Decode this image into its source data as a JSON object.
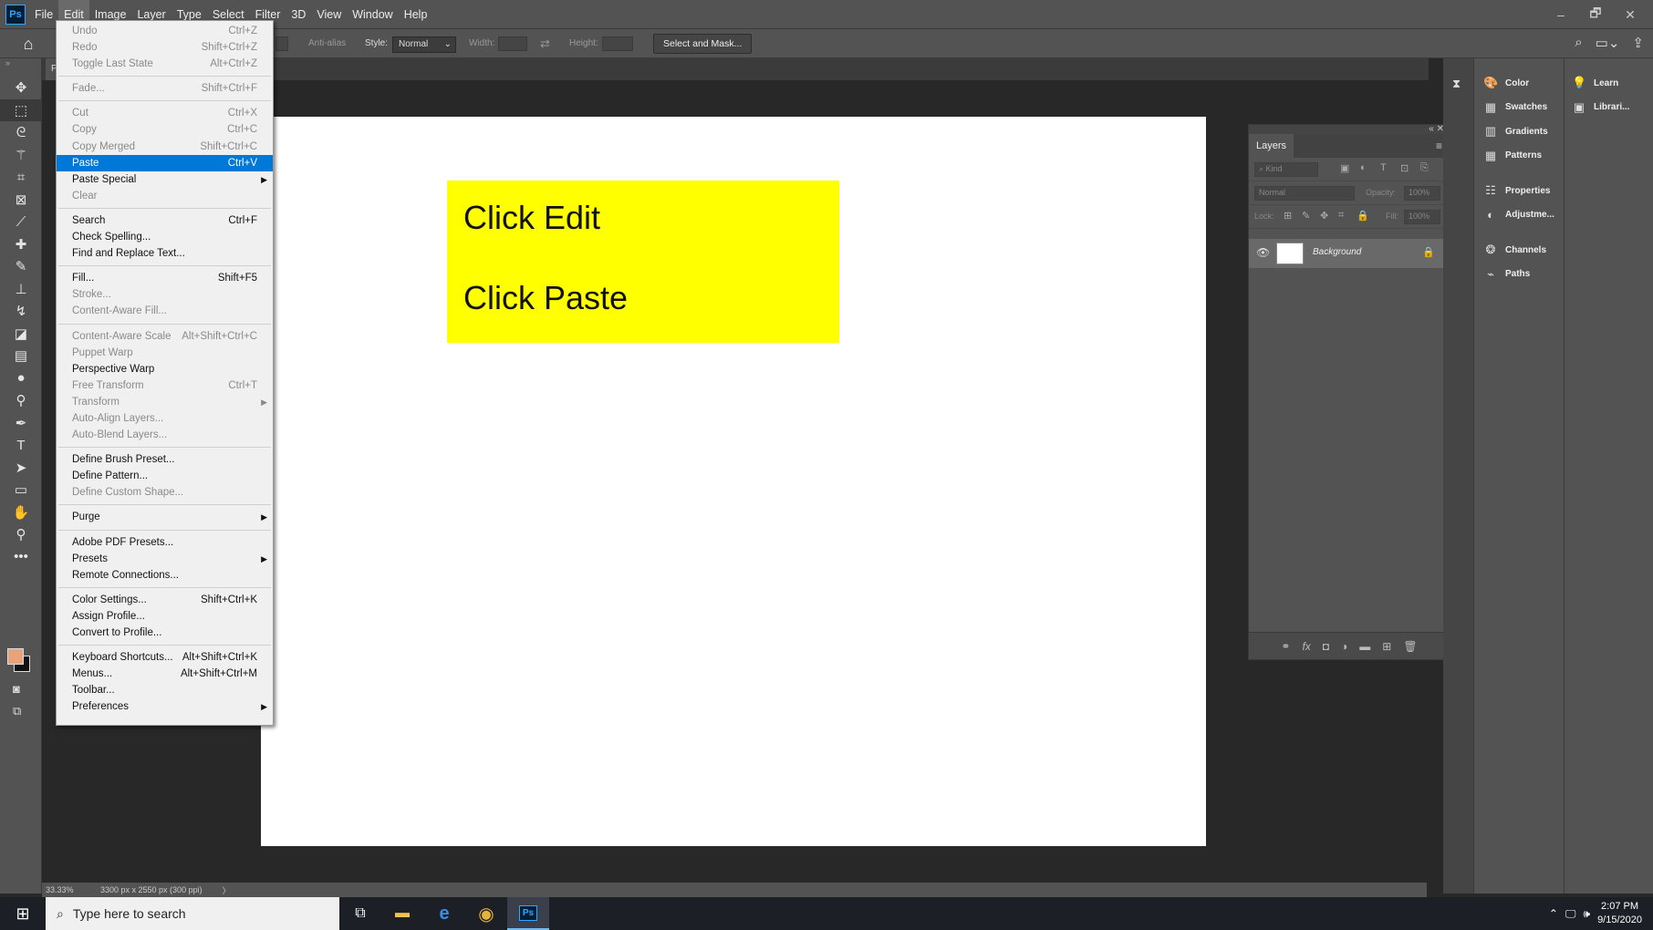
{
  "app": {
    "logo": "Ps"
  },
  "menubar": {
    "items": [
      "File",
      "Edit",
      "Image",
      "Layer",
      "Type",
      "Select",
      "Filter",
      "3D",
      "View",
      "Window",
      "Help"
    ],
    "window_controls": [
      "–",
      "🗗",
      "✕"
    ]
  },
  "options": {
    "antialias_label": "Anti-alias",
    "style_label": "Style:",
    "style_value": "Normal",
    "width_label": "Width:",
    "height_label": "Height:",
    "select_mask_label": "Select and Mask...",
    "right_icons": [
      "search-icon",
      "workspace-icon",
      "share-icon"
    ]
  },
  "edit_menu": {
    "groups": [
      [
        {
          "label": "Undo",
          "shortcut": "Ctrl+Z",
          "disabled": true
        },
        {
          "label": "Redo",
          "shortcut": "Shift+Ctrl+Z",
          "disabled": true
        },
        {
          "label": "Toggle Last State",
          "shortcut": "Alt+Ctrl+Z",
          "disabled": true
        }
      ],
      [
        {
          "label": "Fade...",
          "shortcut": "Shift+Ctrl+F",
          "disabled": true
        }
      ],
      [
        {
          "label": "Cut",
          "shortcut": "Ctrl+X",
          "disabled": true
        },
        {
          "label": "Copy",
          "shortcut": "Ctrl+C",
          "disabled": true
        },
        {
          "label": "Copy Merged",
          "shortcut": "Shift+Ctrl+C",
          "disabled": true
        },
        {
          "label": "Paste",
          "shortcut": "Ctrl+V",
          "highlighted": true
        },
        {
          "label": "Paste Special",
          "submenu": true
        },
        {
          "label": "Clear",
          "disabled": true
        }
      ],
      [
        {
          "label": "Search",
          "shortcut": "Ctrl+F"
        },
        {
          "label": "Check Spelling..."
        },
        {
          "label": "Find and Replace Text..."
        }
      ],
      [
        {
          "label": "Fill...",
          "shortcut": "Shift+F5"
        },
        {
          "label": "Stroke...",
          "disabled": true
        },
        {
          "label": "Content-Aware Fill...",
          "disabled": true
        }
      ],
      [
        {
          "label": "Content-Aware Scale",
          "shortcut": "Alt+Shift+Ctrl+C",
          "disabled": true
        },
        {
          "label": "Puppet Warp",
          "disabled": true
        },
        {
          "label": "Perspective Warp"
        },
        {
          "label": "Free Transform",
          "shortcut": "Ctrl+T",
          "disabled": true
        },
        {
          "label": "Transform",
          "submenu": true,
          "disabled": true
        },
        {
          "label": "Auto-Align Layers...",
          "disabled": true
        },
        {
          "label": "Auto-Blend Layers...",
          "disabled": true
        }
      ],
      [
        {
          "label": "Define Brush Preset..."
        },
        {
          "label": "Define Pattern..."
        },
        {
          "label": "Define Custom Shape...",
          "disabled": true
        }
      ],
      [
        {
          "label": "Purge",
          "submenu": true
        }
      ],
      [
        {
          "label": "Adobe PDF Presets..."
        },
        {
          "label": "Presets",
          "submenu": true
        },
        {
          "label": "Remote Connections..."
        }
      ],
      [
        {
          "label": "Color Settings...",
          "shortcut": "Shift+Ctrl+K"
        },
        {
          "label": "Assign Profile..."
        },
        {
          "label": "Convert to Profile..."
        }
      ],
      [
        {
          "label": "Keyboard Shortcuts...",
          "shortcut": "Alt+Shift+Ctrl+K"
        },
        {
          "label": "Menus...",
          "shortcut": "Alt+Shift+Ctrl+M"
        },
        {
          "label": "Toolbar..."
        },
        {
          "label": "Preferences",
          "submenu": true
        }
      ]
    ]
  },
  "canvas": {
    "note_line1": "Click Edit",
    "note_line2": "Click Paste",
    "note_color": "#ffff00"
  },
  "status": {
    "zoom": "33.33%",
    "doc_info": "3300 px x 2550 px (300 ppi)"
  },
  "layers_panel": {
    "tab": "Layers",
    "kind_placeholder": "Kind",
    "blend_mode": "Normal",
    "opacity_label": "Opacity:",
    "opacity_value": "100%",
    "lock_label": "Lock:",
    "fill_label": "Fill:",
    "fill_value": "100%",
    "layer_name": "Background"
  },
  "right_dock": {
    "group1": [
      {
        "icon": "color-icon",
        "label": "Color"
      },
      {
        "icon": "swatches-icon",
        "label": "Swatches"
      },
      {
        "icon": "gradients-icon",
        "label": "Gradients"
      },
      {
        "icon": "patterns-icon",
        "label": "Patterns"
      }
    ],
    "group2": [
      {
        "icon": "properties-icon",
        "label": "Properties"
      },
      {
        "icon": "adjustments-icon",
        "label": "Adjustme..."
      }
    ],
    "group3": [
      {
        "icon": "channels-icon",
        "label": "Channels"
      },
      {
        "icon": "paths-icon",
        "label": "Paths"
      }
    ],
    "group4": [
      {
        "icon": "learn-icon",
        "label": "Learn"
      },
      {
        "icon": "libraries-icon",
        "label": "Librari..."
      }
    ]
  },
  "taskbar": {
    "search_placeholder": "Type here to search",
    "time": "2:07 PM",
    "date": "9/15/2020"
  },
  "colors": {
    "foreground": "#e8a27c",
    "background": "#111111",
    "menu_highlight": "#0078d7"
  }
}
